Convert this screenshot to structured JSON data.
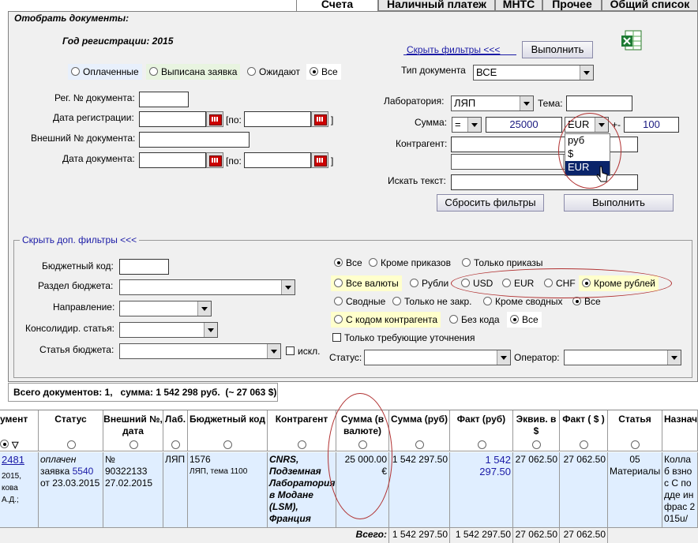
{
  "tabs": [
    "Счета",
    "Наличный платеж",
    "МНТС",
    "Прочее",
    "Общий список"
  ],
  "filter_title": "Отобрать документы:",
  "year_label": "Год регистрации: 2015",
  "status_radios": [
    "Оплаченные",
    "Выписана заявка",
    "Ожидают",
    "Все"
  ],
  "hide_filters_link": "Скрыть фильтры <<<",
  "execute_button": "Выполнить",
  "doc_type": {
    "label": "Тип документа",
    "value": "ВСЕ"
  },
  "reg_no_label": "Рег. № документа:",
  "reg_date_label": "Дата регистрации:",
  "date_to_label": "[по:",
  "bracket_close": "]",
  "ext_no_label": "Внешний № документа:",
  "doc_date_label": "Дата документа:",
  "lab": {
    "label": "Лаборатория:",
    "value": "ЛЯП"
  },
  "topic_label": "Тема:",
  "sum": {
    "label": "Сумма:",
    "op": "=",
    "value": "25000",
    "currency": "EUR",
    "pm": "+-",
    "tolerance": "100"
  },
  "currency_dropdown": [
    "руб",
    "$",
    "EUR"
  ],
  "contractor_label": "Контрагент:",
  "search_text_label": "Искать текст:",
  "reset_button": "Сбросить фильтры",
  "execute_button2": "Выполнить",
  "extra_filters_legend": "Скрыть доп. фильтры <<<",
  "budget_code_label": "Бюджетный код:",
  "budget_section_label": "Раздел бюджета:",
  "direction_label": "Направление:",
  "consol_label": "Консолидир. статья:",
  "budget_item_label": "Статья бюджета:",
  "excl_label": "искл.",
  "order_radios": [
    "Все",
    "Кроме приказов",
    "Только приказы"
  ],
  "currency_radios": [
    "Все валюты",
    "Рубли",
    "USD",
    "EUR",
    "CHF",
    "Кроме рублей"
  ],
  "summary_radios": [
    "Сводные",
    "Только не закр.",
    "Кроме сводных",
    "Все"
  ],
  "contractor_radios": [
    "С кодом контрагента",
    "Без кода",
    "Все"
  ],
  "clarify_label": "Только требующие уточнения",
  "status_label": "Статус:",
  "operator_label": "Оператор:",
  "totals_line": "Всего документов: 1,   сумма: 1 542 298 руб.  (~ 27 063 $)",
  "columns": [
    "умент",
    "Статус",
    "Внешний №, дата",
    "Лаб.",
    "Бюджетный код",
    "Контрагент",
    "Сумма (в валюте)",
    "Сумма (руб)",
    "Факт (руб)",
    "Эквив. в $",
    "Факт ( $ )",
    "Статья",
    "Назнач"
  ],
  "row": {
    "doc_no": "2481",
    "doc_year": "2015,",
    "doc_author": "кова А.Д.;",
    "status_1": "оплачен",
    "status_2": "заявка",
    "status_num": "5540",
    "status_3": "от 23.03.2015",
    "ext_1": "№",
    "ext_2": "90322133",
    "ext_3": "27.02.2015",
    "lab": "ЛЯП",
    "budget_code": "1576",
    "budget_sub": "ЛЯП, тема 1100",
    "contractor": "CNRS, Подземная Лаборатория в Модане (LSM), Франция",
    "sum_cur": "25 000.00",
    "sum_cur_sym": "€",
    "sum_rub": "1 542 297.50",
    "fact_rub": "1 542 297.50",
    "eq_usd": "27 062.50",
    "fact_usd": "27 062.50",
    "article_1": "05",
    "article_2": "Материалы",
    "purpose": "Коллаб взнос С подде инфрас 2015u/"
  },
  "footer": {
    "label": "Всего:",
    "sum_rub": "1 542 297.50",
    "fact_rub": "1 542 297.50",
    "eq_usd": "27 062.50",
    "fact_usd": "27 062.50"
  }
}
